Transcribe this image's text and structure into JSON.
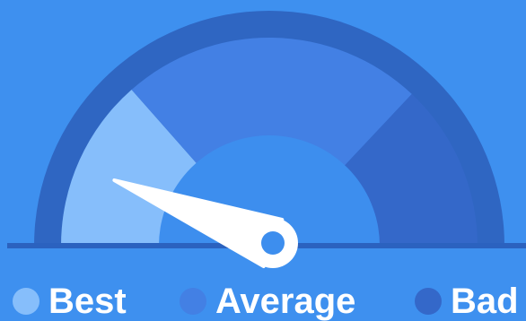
{
  "gauge": {
    "needle_value": 0.12,
    "segments": [
      {
        "name": "Best",
        "color": "#86befb"
      },
      {
        "name": "Average",
        "color": "#4380e4"
      },
      {
        "name": "Bad",
        "color": "#3468c9"
      }
    ],
    "colors": {
      "background": "#3e90ef",
      "rim": "#2f66c2",
      "hub": "#3d8eee",
      "baseline": "#2b62bf",
      "needle": "#ffffff"
    }
  },
  "legend": [
    {
      "label": "Best",
      "color": "#86befb"
    },
    {
      "label": "Average",
      "color": "#4380e4"
    },
    {
      "label": "Bad",
      "color": "#3468c9"
    }
  ]
}
